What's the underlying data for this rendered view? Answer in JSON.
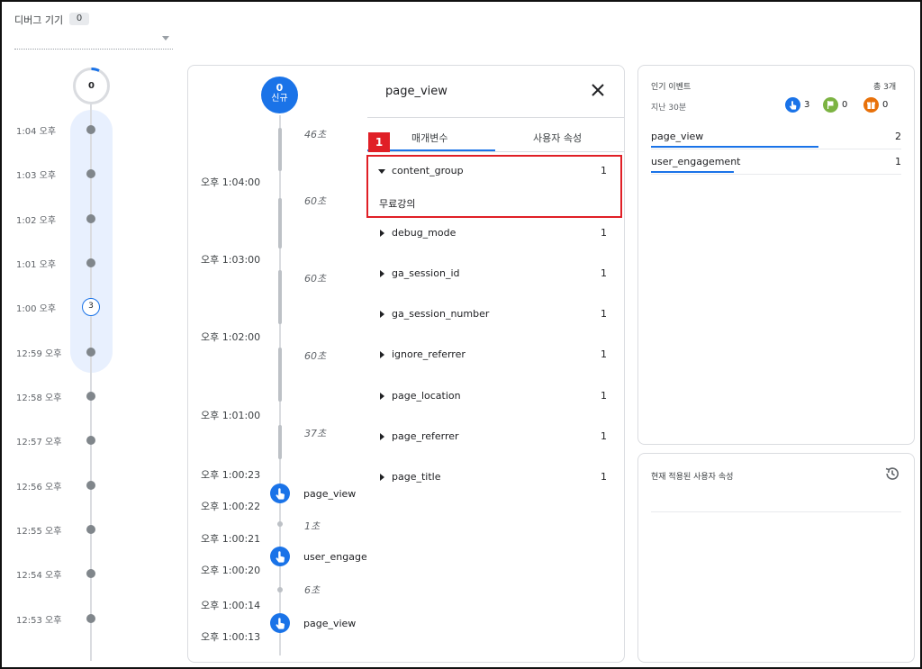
{
  "header": {
    "label": "디버그 기기",
    "count": "0"
  },
  "minutes": {
    "ring_count": "0",
    "rows": [
      {
        "label": "1:04 오후"
      },
      {
        "label": "1:03 오후"
      },
      {
        "label": "1:02 오후"
      },
      {
        "label": "1:01 오후"
      },
      {
        "label": "1:00 오후",
        "badge": "3"
      },
      {
        "label": "12:59 오후"
      },
      {
        "label": "12:58 오후"
      },
      {
        "label": "12:57 오후"
      },
      {
        "label": "12:56 오후"
      },
      {
        "label": "12:55 오후"
      },
      {
        "label": "12:54 오후"
      },
      {
        "label": "12:53 오후"
      }
    ]
  },
  "stream": {
    "new_count": "0",
    "new_label": "신규",
    "times": [
      "오후 1:04:00",
      "오후 1:03:00",
      "오후 1:02:00",
      "오후 1:01:00",
      "오후 1:00:23",
      "오후 1:00:22",
      "오후 1:00:21",
      "오후 1:00:20",
      "오후 1:00:14",
      "오후 1:00:13"
    ],
    "durations": [
      "46초",
      "60초",
      "60초",
      "60초",
      "37초",
      "1초",
      "6초"
    ],
    "events": [
      "page_view",
      "user_engagement",
      "page_view"
    ]
  },
  "details": {
    "title": "page_view",
    "tabs": [
      "매개변수",
      "사용자 속성"
    ],
    "params": [
      {
        "name": "content_group",
        "count": "1",
        "value": "무료강의"
      },
      {
        "name": "debug_mode",
        "count": "1"
      },
      {
        "name": "ga_session_id",
        "count": "1"
      },
      {
        "name": "ga_session_number",
        "count": "1"
      },
      {
        "name": "ignore_referrer",
        "count": "1"
      },
      {
        "name": "page_location",
        "count": "1"
      },
      {
        "name": "page_referrer",
        "count": "1"
      },
      {
        "name": "page_title",
        "count": "1"
      }
    ],
    "annotation": "1"
  },
  "top_events": {
    "title": "인기 이벤트",
    "total": "총 3개",
    "subtitle": "지난 30분",
    "categories": [
      {
        "count": "3",
        "color": "#1a73e8",
        "icon": "touch-icon"
      },
      {
        "count": "0",
        "color": "#7cb342",
        "icon": "flag-icon"
      },
      {
        "count": "0",
        "color": "#e8710a",
        "icon": "gift-icon"
      }
    ],
    "rows": [
      {
        "name": "page_view",
        "count": "2",
        "share": 0.67
      },
      {
        "name": "user_engagement",
        "count": "1",
        "share": 0.33
      }
    ]
  },
  "user_props": {
    "title": "현재 적용된 사용자 속성"
  }
}
